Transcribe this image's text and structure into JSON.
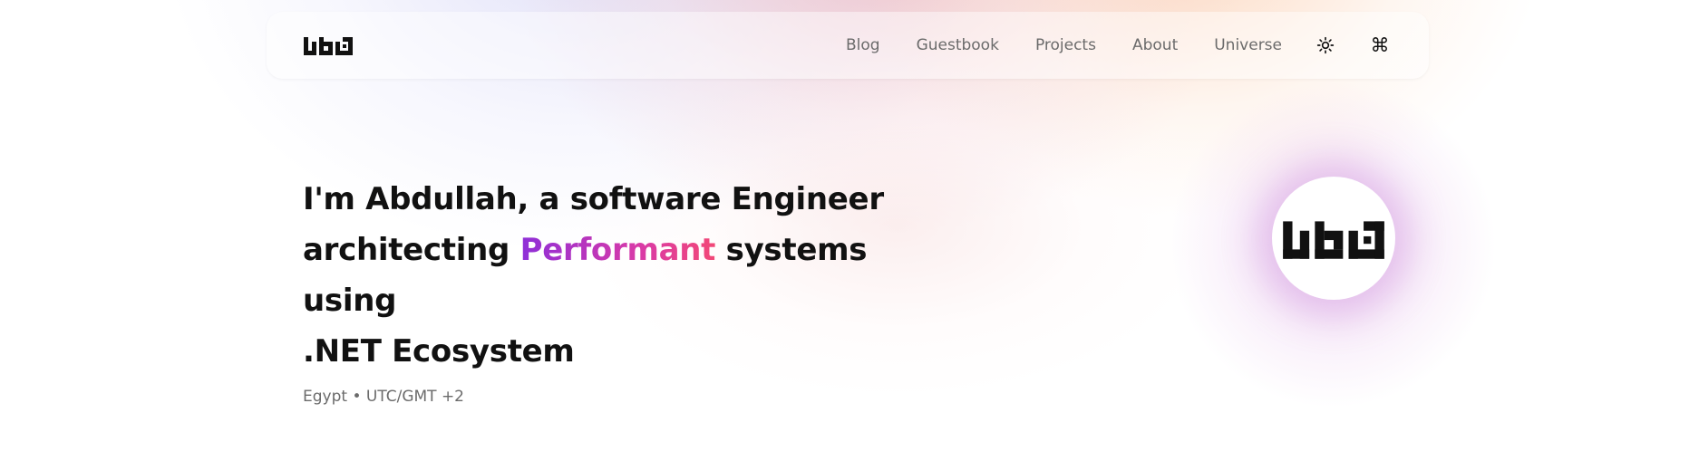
{
  "brand": {
    "logo_text": "حكيم"
  },
  "nav": {
    "links": [
      {
        "label": "Blog"
      },
      {
        "label": "Guestbook"
      },
      {
        "label": "Projects"
      },
      {
        "label": "About"
      },
      {
        "label": "Universe"
      }
    ],
    "theme_toggle_icon": "sun-icon",
    "command_icon": "command-icon"
  },
  "hero": {
    "line1": "I'm Abdullah, a software Engineer",
    "line2_before": "architecting ",
    "line2_accent": "Performant",
    "line2_after": " systems using",
    "line3": ".NET Ecosystem",
    "location": "Egypt • UTC/GMT +2"
  },
  "avatar": {
    "logo_text": "حكيم"
  },
  "colors": {
    "text": "#111111",
    "muted": "#6b6b6b",
    "accent_start": "#8e2fd8",
    "accent_end": "#f24877"
  }
}
